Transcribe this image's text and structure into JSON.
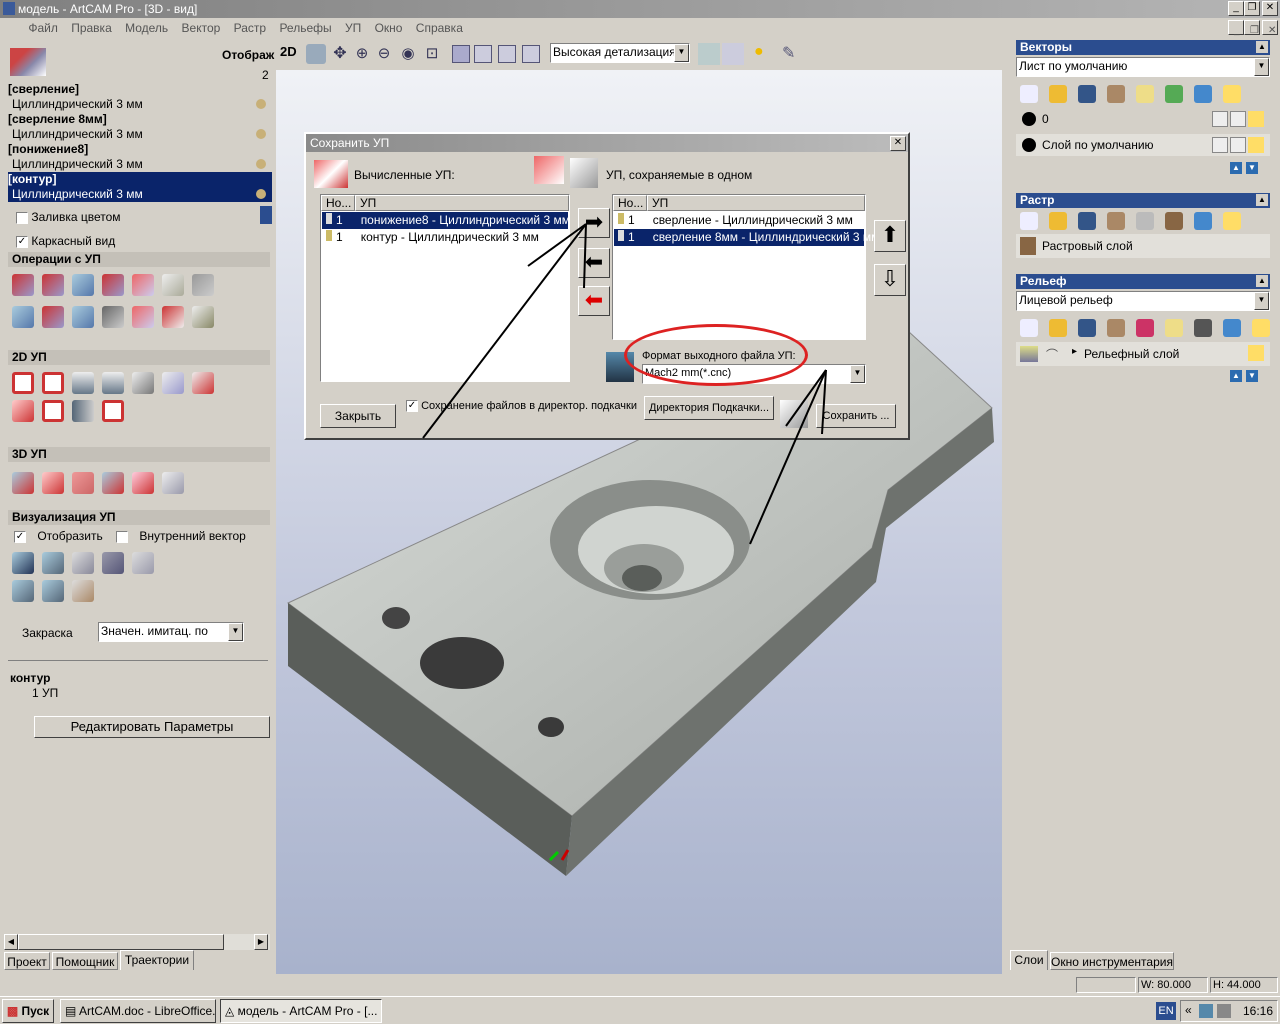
{
  "window": {
    "title": "модель - ArtCAM Pro - [3D - вид]"
  },
  "menu": [
    "Файл",
    "Правка",
    "Модель",
    "Вектор",
    "Растр",
    "Рельефы",
    "УП",
    "Окно",
    "Справка"
  ],
  "left": {
    "top_label": "Отображ",
    "top_value": "2",
    "toolpaths": [
      {
        "name": "[сверление]",
        "tool": "Циллиндрический 3 мм"
      },
      {
        "name": "[сверление 8мм]",
        "tool": "Циллиндрический 3 мм"
      },
      {
        "name": "[понижение8]",
        "tool": "Циллиндрический 3 мм"
      },
      {
        "name": "[контур]",
        "tool": "Циллиндрический 3 мм"
      }
    ],
    "fill_color": "Заливка цветом",
    "wireframe": "Каркасный вид",
    "ops_title": "Операции с УП",
    "ops2d_title": "2D УП",
    "ops3d_title": "3D УП",
    "viz_title": "Визуализация УП",
    "viz_show": "Отобразить",
    "viz_inner": "Внутренний вектор",
    "shading_label": "Закраска",
    "shading_value": "Значен. имитац. по",
    "sel_name": "контур",
    "sel_count": "1 УП",
    "edit_params": "Редактировать Параметры",
    "tabs": [
      "Проект",
      "Помощник",
      "Траектории"
    ]
  },
  "toolbar": {
    "mode": "2D",
    "detail": "Высокая детализация"
  },
  "dialog": {
    "title": "Сохранить УП",
    "computed_label": "Вычисленные УП:",
    "saved_label": "УП, сохраняемые в одном",
    "col_no": "Но...",
    "col_up": "УП",
    "computed": [
      {
        "no": "1",
        "name": "понижение8 - Циллиндрический 3 мм"
      },
      {
        "no": "1",
        "name": "контур - Циллиндрический 3 мм"
      }
    ],
    "saved": [
      {
        "no": "1",
        "name": "сверление - Циллиндрический 3 мм"
      },
      {
        "no": "1",
        "name": "сверление 8мм - Циллиндрический 3 мм"
      }
    ],
    "format_label": "Формат выходного файла УП:",
    "format_value": "Mach2 mm(*.cnc)",
    "close": "Закрыть",
    "save_dir_chk": "Сохранение файлов в директор. подкачки",
    "dir_btn": "Директория Подкачки...",
    "save_btn": "Сохранить ..."
  },
  "right": {
    "vectors_title": "Векторы",
    "vectors_sheet": "Лист по умолчанию",
    "layer0": "0",
    "layer_default": "Слой по умолчанию",
    "raster_title": "Растр",
    "raster_layer": "Растровый слой",
    "relief_title": "Рельеф",
    "relief_combo": "Лицевой рельеф",
    "relief_layer": "Рельефный слой",
    "tabs": [
      "Слои",
      "Окно инструментария"
    ]
  },
  "status": {
    "w": "W: 80.000",
    "h": "H: 44.000"
  },
  "taskbar": {
    "start": "Пуск",
    "task1": "ArtCAM.doc - LibreOffice...",
    "task2": "модель - ArtCAM Pro - [...",
    "lang": "EN",
    "time": "16:16"
  }
}
